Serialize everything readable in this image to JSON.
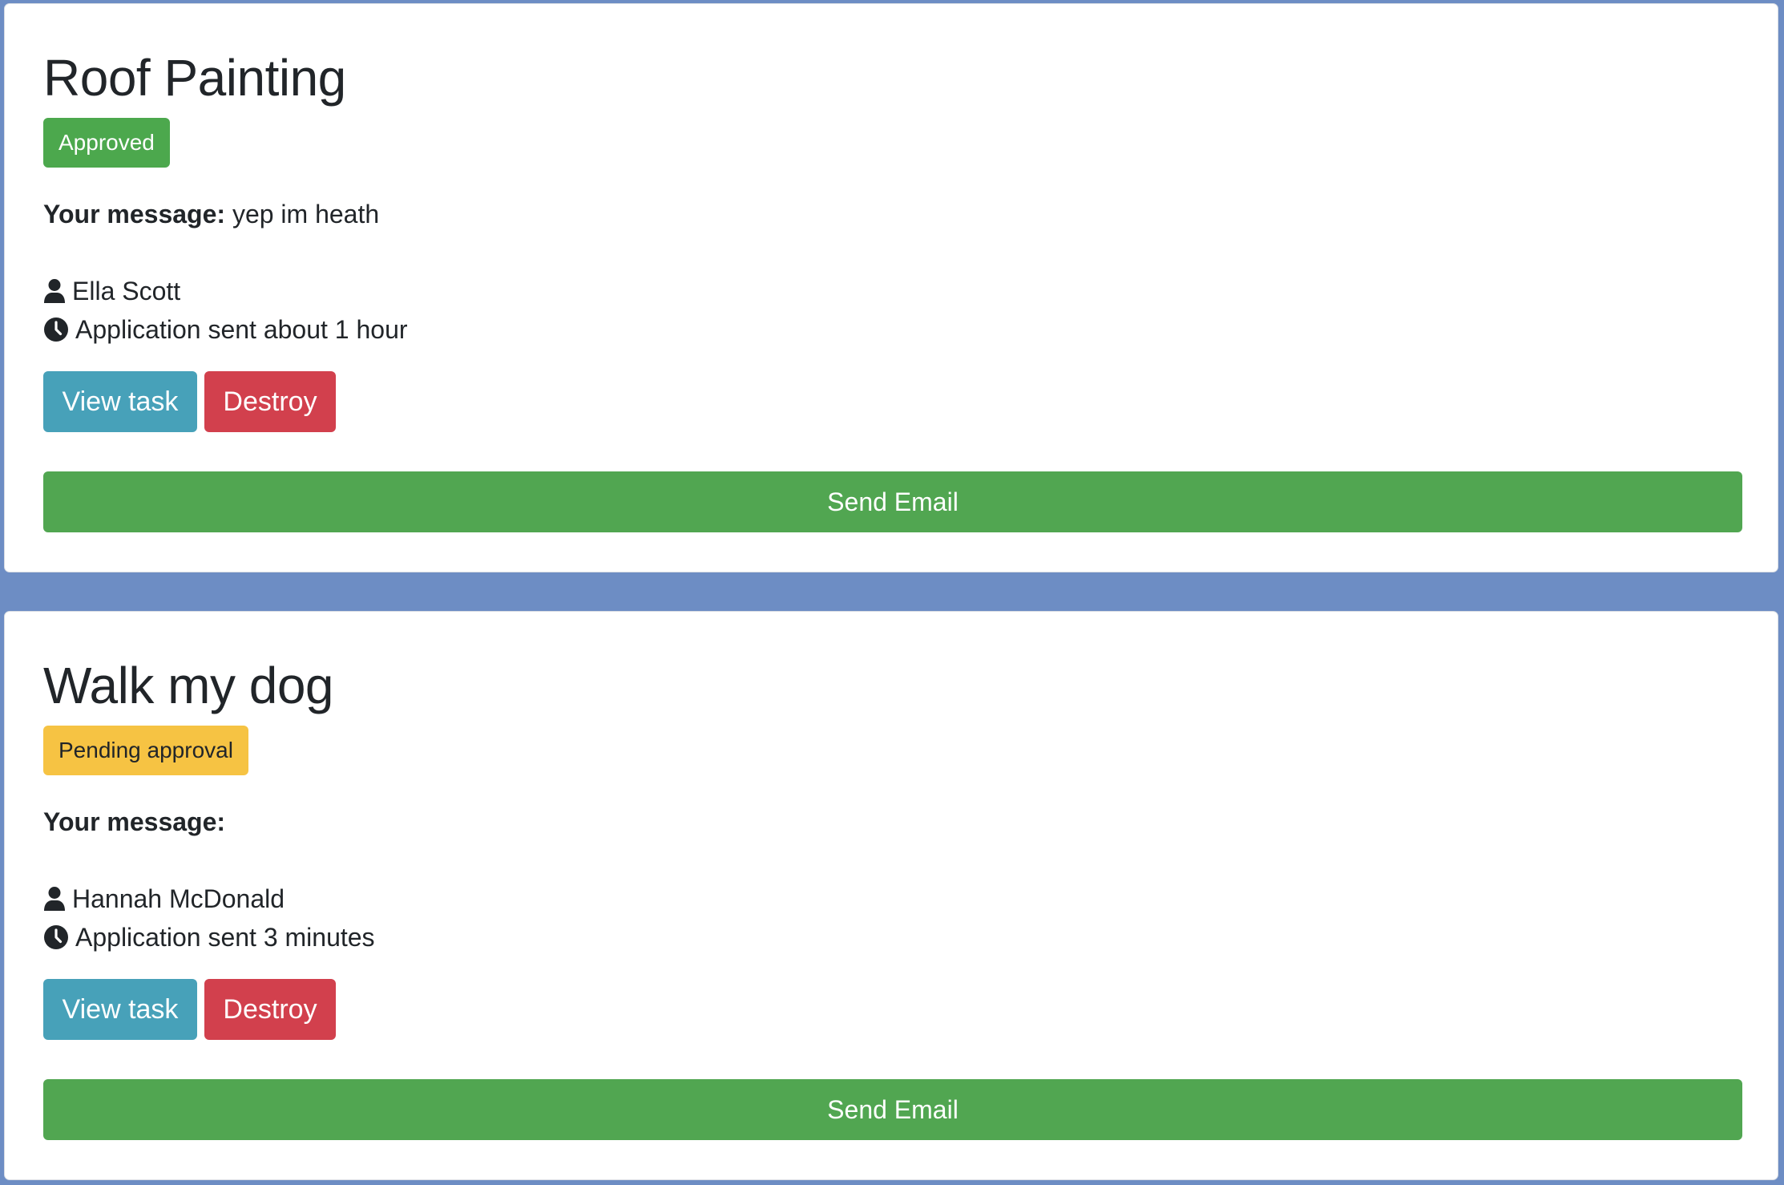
{
  "applications": [
    {
      "task_title": "Roof Painting",
      "status": "Approved",
      "message_label": "Your message:",
      "message_text": "yep im heath",
      "user_name": "Ella Scott",
      "sent_text": "Application sent about 1 hour",
      "view_label": "View task",
      "destroy_label": "Destroy",
      "email_label": "Send Email"
    },
    {
      "task_title": "Walk my dog",
      "status": "Pending approval",
      "message_label": "Your message:",
      "message_text": "",
      "user_name": "Hannah McDonald",
      "sent_text": "Application sent 3 minutes",
      "view_label": "View task",
      "destroy_label": "Destroy",
      "email_label": "Send Email"
    }
  ],
  "icons": {
    "user": "user-icon",
    "time": "clock-icon"
  },
  "colors": {
    "page_background": "#6d8dc4",
    "approved": "#4ca84d",
    "pending": "#f6c343",
    "view_button": "#47a1b9",
    "destroy_button": "#d2404d",
    "send_email_button": "#51a651"
  }
}
